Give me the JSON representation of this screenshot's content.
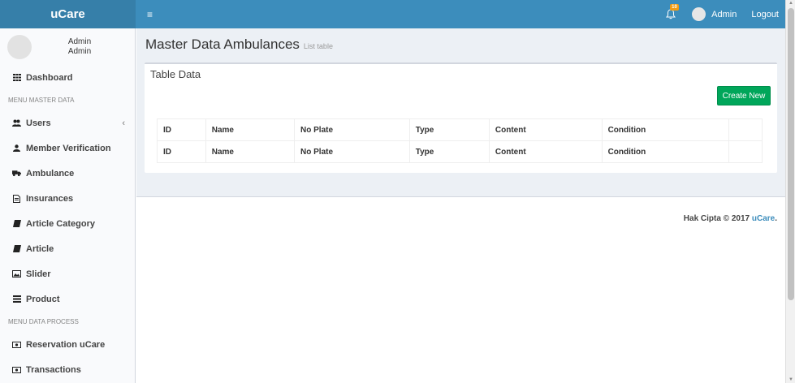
{
  "app": {
    "logo": "uCare"
  },
  "topbar": {
    "menu_icon": "≡",
    "notification_count": "10",
    "user_name": "Admin",
    "logout": "Logout"
  },
  "sidebar": {
    "user": {
      "name": "Admin",
      "role": "Admin"
    },
    "dashboard": "Dashboard",
    "header_master": "MENU MASTER DATA",
    "users": "Users",
    "users_chevron": "‹",
    "member_verification": "Member Verification",
    "ambulance": "Ambulance",
    "insurances": "Insurances",
    "article_category": "Article Category",
    "article": "Article",
    "slider": "Slider",
    "product": "Product",
    "header_process": "MENU DATA PROCESS",
    "reservation": "Reservation uCare",
    "transactions": "Transactions"
  },
  "page": {
    "title": "Master Data Ambulances",
    "subtitle": "List table"
  },
  "box": {
    "title": "Table Data",
    "create_button": "Create New"
  },
  "table": {
    "rows": [
      [
        "ID",
        "Name",
        "No Plate",
        "Type",
        "Content",
        "Condition",
        ""
      ],
      [
        "ID",
        "Name",
        "No Plate",
        "Type",
        "Content",
        "Condition",
        ""
      ]
    ]
  },
  "footer": {
    "text": "Hak Cipta © 2017",
    "brand": "uCare",
    "suffix": "."
  },
  "colors": {
    "header": "#3c8dbc",
    "logo_bg": "#367fa9",
    "create_button": "#00a65a",
    "badge": "#f39c12"
  }
}
